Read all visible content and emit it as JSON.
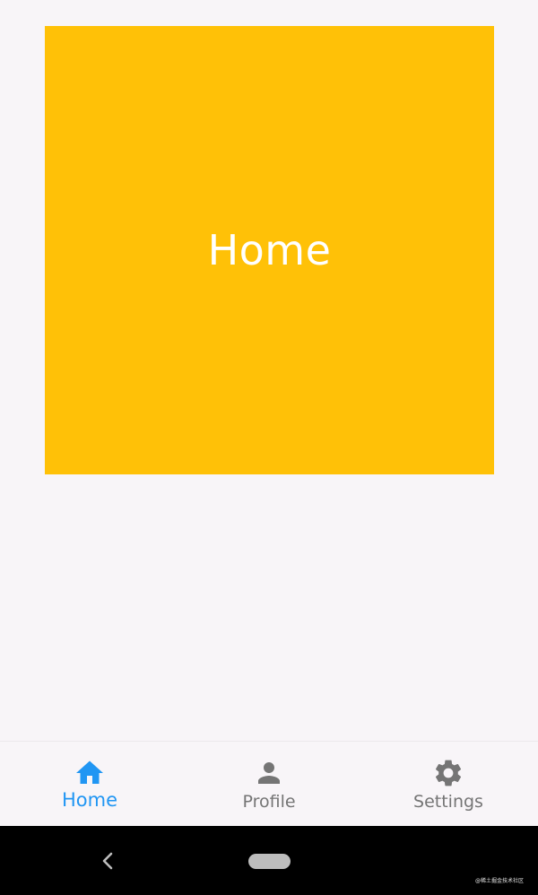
{
  "main": {
    "title": "Home",
    "card_color": "#ffc107"
  },
  "bottom_nav": {
    "active_color": "#2196f3",
    "inactive_color": "#757575",
    "items": [
      {
        "label": "Home",
        "icon": "home-icon",
        "active": true
      },
      {
        "label": "Profile",
        "icon": "person-icon",
        "active": false
      },
      {
        "label": "Settings",
        "icon": "gear-icon",
        "active": false
      }
    ]
  },
  "system_nav": {
    "back_icon": "chevron-left-icon",
    "home_icon": "pill-home-icon"
  },
  "watermark": {
    "text": "@稀土掘金技术社区"
  }
}
